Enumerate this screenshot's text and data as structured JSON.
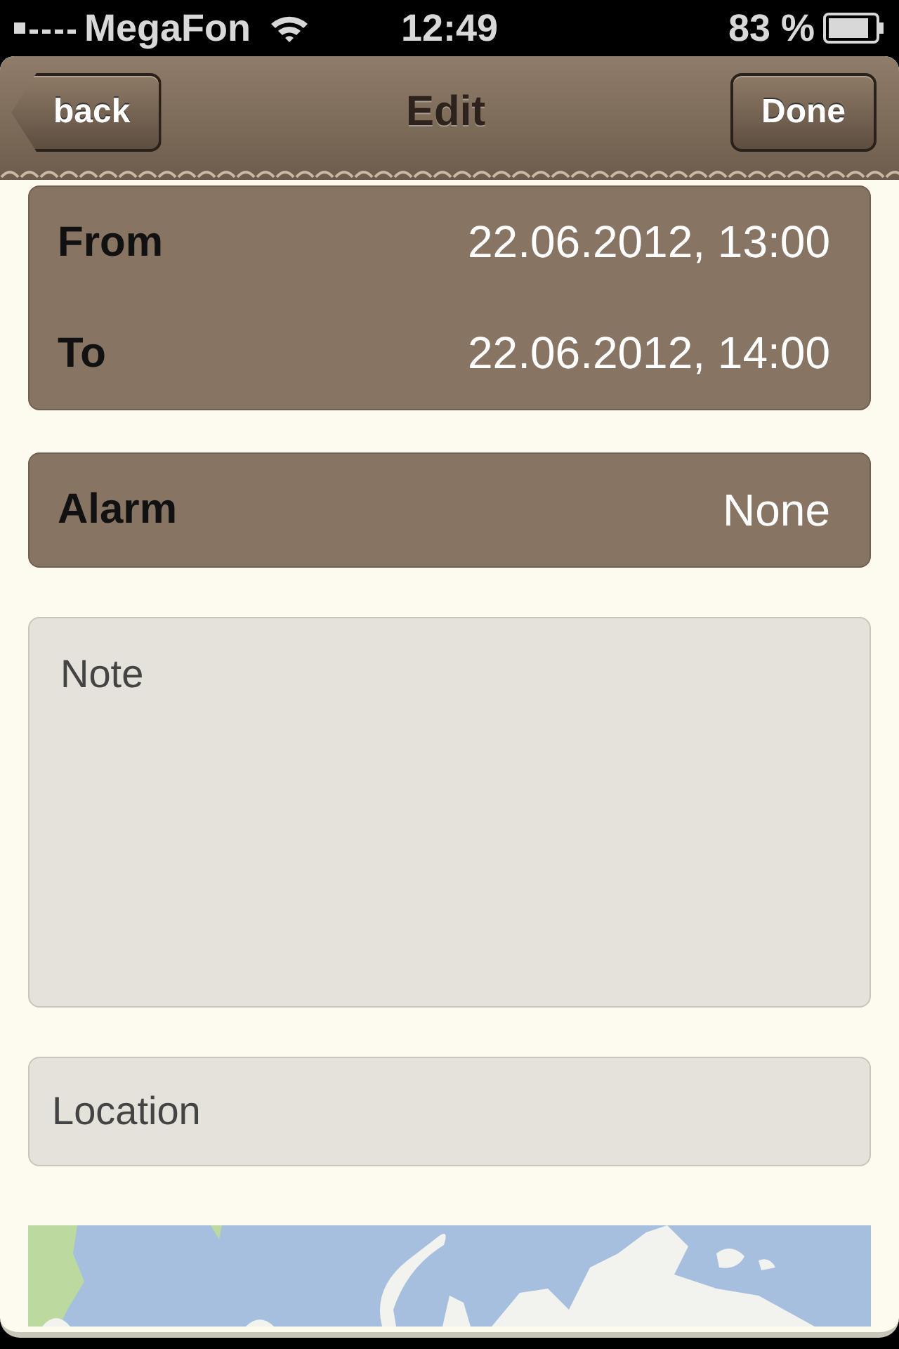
{
  "status_bar": {
    "carrier": "MegaFon",
    "time": "12:49",
    "battery": "83 %"
  },
  "nav_bar": {
    "back": "back",
    "title": "Edit",
    "done": "Done"
  },
  "date_rows": [
    {
      "label": "From",
      "value": "22.06.2012, 13:00"
    },
    {
      "label": "To",
      "value": "22.06.2012, 14:00"
    }
  ],
  "alarm": {
    "label": "Alarm",
    "value": "None"
  },
  "note": {
    "placeholder": "Note"
  },
  "location": {
    "placeholder": "Location"
  }
}
